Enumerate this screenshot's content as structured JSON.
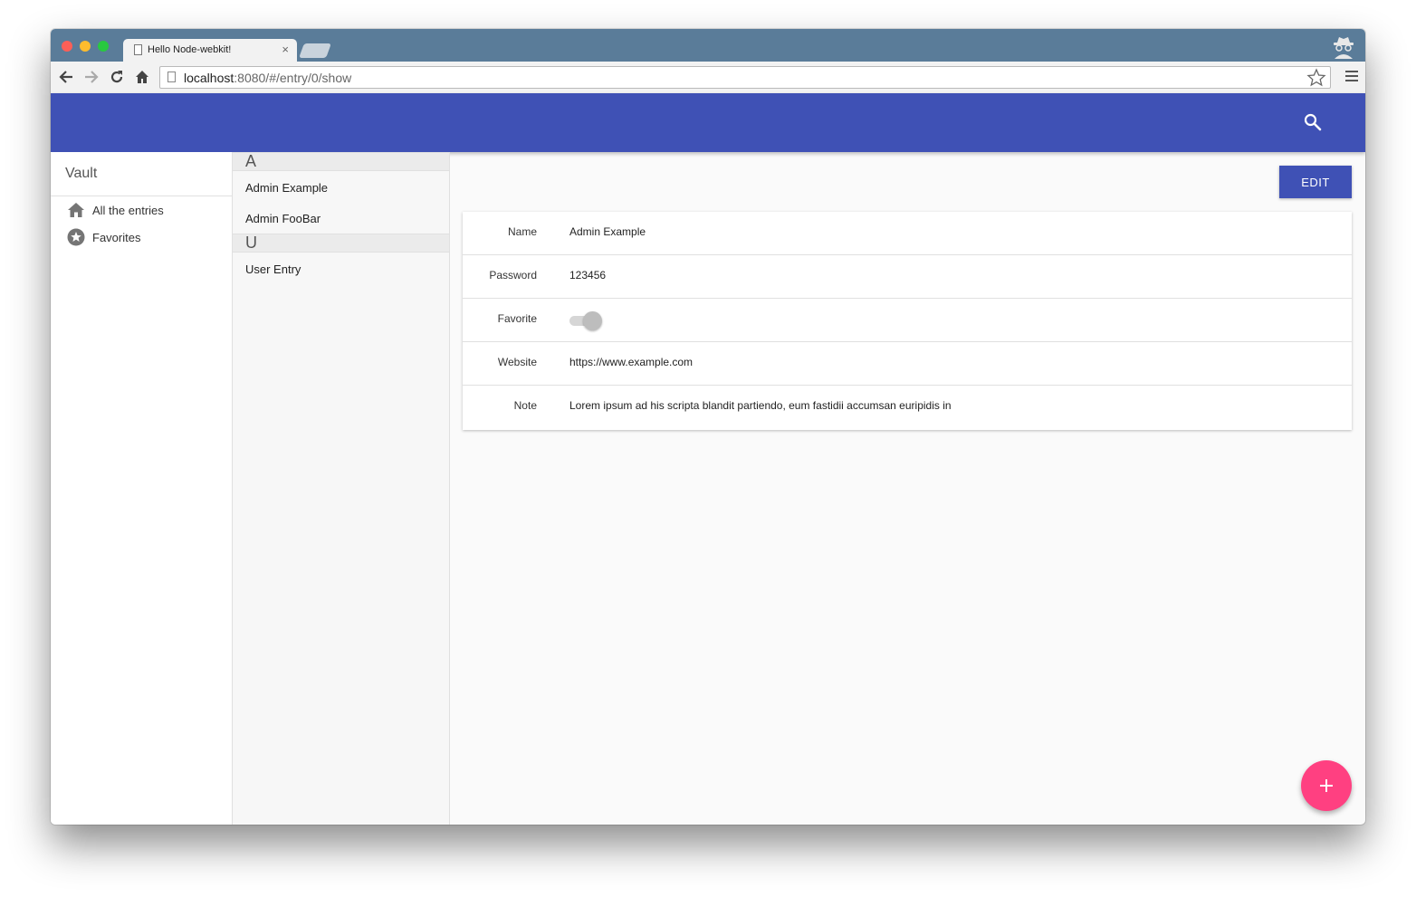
{
  "browser": {
    "tab_title": "Hello Node-webkit!",
    "tab_close": "×",
    "url_host": "localhost",
    "url_rest": ":8080/#/entry/0/show"
  },
  "sidebar": {
    "title": "Vault",
    "items": [
      {
        "label": "All the entries",
        "icon": "home-icon"
      },
      {
        "label": "Favorites",
        "icon": "star-circle-icon"
      }
    ]
  },
  "list": {
    "groups": [
      {
        "letter": "A",
        "entries": [
          "Admin Example",
          "Admin FooBar"
        ]
      },
      {
        "letter": "U",
        "entries": [
          "User Entry"
        ]
      }
    ]
  },
  "detail": {
    "edit_label": "EDIT",
    "fields": [
      {
        "label": "Name",
        "value": "Admin Example"
      },
      {
        "label": "Password",
        "value": "123456"
      },
      {
        "label": "Favorite",
        "value": ""
      },
      {
        "label": "Website",
        "value": "https://www.example.com"
      },
      {
        "label": "Note",
        "value": "Lorem ipsum ad his scripta blandit partiendo, eum fastidii accumsan euripidis in"
      }
    ],
    "favorite_on": false
  },
  "fab": {
    "label": "+"
  },
  "colors": {
    "primary": "#3f51b5",
    "accent": "#ff4081",
    "tabstrip": "#5a7c99"
  }
}
